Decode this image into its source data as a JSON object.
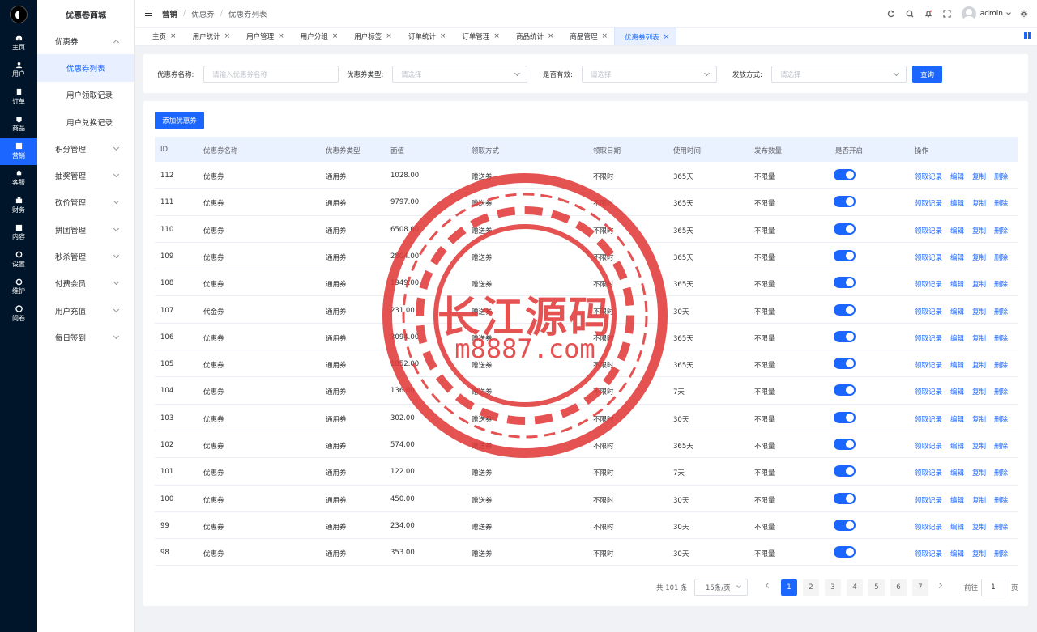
{
  "app": {
    "title": "优惠卷商城"
  },
  "rail": [
    {
      "label": "主页",
      "icon": "home-icon"
    },
    {
      "label": "用户",
      "icon": "user-icon"
    },
    {
      "label": "订单",
      "icon": "order-icon"
    },
    {
      "label": "商品",
      "icon": "goods-icon"
    },
    {
      "label": "营销",
      "icon": "marketing-icon",
      "active": true
    },
    {
      "label": "客服",
      "icon": "service-icon"
    },
    {
      "label": "财务",
      "icon": "finance-icon"
    },
    {
      "label": "内容",
      "icon": "content-icon"
    },
    {
      "label": "设置",
      "icon": "settings-icon"
    },
    {
      "label": "维护",
      "icon": "maintenance-icon"
    },
    {
      "label": "问卷",
      "icon": "survey-icon"
    }
  ],
  "submenu": {
    "group_open": "优惠券",
    "sub_items": [
      "优惠券列表",
      "用户领取记录",
      "用户兑换记录"
    ],
    "groups": [
      "积分管理",
      "抽奖管理",
      "砍价管理",
      "拼团管理",
      "秒杀管理",
      "付费会员",
      "用户充值",
      "每日签到"
    ]
  },
  "header": {
    "breadcrumb": [
      "营销",
      "优惠券",
      "优惠券列表"
    ],
    "user": "admin"
  },
  "tabs": [
    "主页",
    "用户统计",
    "用户管理",
    "用户分组",
    "用户标签",
    "订单统计",
    "订单管理",
    "商品统计",
    "商品管理",
    "优惠券列表"
  ],
  "filter": {
    "name_label": "优惠券名称:",
    "name_placeholder": "请输入优惠券名称",
    "type_label": "优惠券类型:",
    "type_placeholder": "请选择",
    "valid_label": "是否有效:",
    "valid_placeholder": "请选择",
    "issue_label": "发放方式:",
    "issue_placeholder": "请选择",
    "query_button": "查询"
  },
  "table": {
    "add_button": "添加优惠券",
    "columns": [
      "ID",
      "优惠券名称",
      "优惠券类型",
      "面值",
      "领取方式",
      "领取日期",
      "使用时间",
      "发布数量",
      "是否开启",
      "操作"
    ],
    "rows": [
      {
        "id": "112",
        "name": "优惠券",
        "type": "通用券",
        "value": "1028.00",
        "method": "赠送券",
        "date": "不限时",
        "use": "365天",
        "qty": "不限量",
        "on": true
      },
      {
        "id": "111",
        "name": "优惠券",
        "type": "通用券",
        "value": "9797.00",
        "method": "赠送券",
        "date": "不限时",
        "use": "365天",
        "qty": "不限量",
        "on": true
      },
      {
        "id": "110",
        "name": "优惠券",
        "type": "通用券",
        "value": "6508.00",
        "method": "赠送券",
        "date": "不限时",
        "use": "365天",
        "qty": "不限量",
        "on": true
      },
      {
        "id": "109",
        "name": "优惠券",
        "type": "通用券",
        "value": "2804.00",
        "method": "赠送券",
        "date": "不限时",
        "use": "365天",
        "qty": "不限量",
        "on": true
      },
      {
        "id": "108",
        "name": "优惠券",
        "type": "通用券",
        "value": "1949.00",
        "method": "赠送券",
        "date": "不限时",
        "use": "365天",
        "qty": "不限量",
        "on": true
      },
      {
        "id": "107",
        "name": "代金券",
        "type": "通用券",
        "value": "231.00",
        "method": "赠送券",
        "date": "不限时",
        "use": "30天",
        "qty": "不限量",
        "on": true
      },
      {
        "id": "106",
        "name": "优惠券",
        "type": "通用券",
        "value": "3094.00",
        "method": "赠送券",
        "date": "不限时",
        "use": "365天",
        "qty": "不限量",
        "on": true
      },
      {
        "id": "105",
        "name": "优惠券",
        "type": "通用券",
        "value": "1852.00",
        "method": "赠送券",
        "date": "不限时",
        "use": "365天",
        "qty": "不限量",
        "on": true
      },
      {
        "id": "104",
        "name": "优惠券",
        "type": "通用券",
        "value": "136.00",
        "method": "赠送券",
        "date": "不限时",
        "use": "7天",
        "qty": "不限量",
        "on": true
      },
      {
        "id": "103",
        "name": "优惠券",
        "type": "通用券",
        "value": "302.00",
        "method": "赠送券",
        "date": "不限时",
        "use": "30天",
        "qty": "不限量",
        "on": true
      },
      {
        "id": "102",
        "name": "优惠券",
        "type": "通用券",
        "value": "574.00",
        "method": "赠送券",
        "date": "不限时",
        "use": "365天",
        "qty": "不限量",
        "on": true
      },
      {
        "id": "101",
        "name": "优惠券",
        "type": "通用券",
        "value": "122.00",
        "method": "赠送券",
        "date": "不限时",
        "use": "7天",
        "qty": "不限量",
        "on": true
      },
      {
        "id": "100",
        "name": "优惠券",
        "type": "通用券",
        "value": "450.00",
        "method": "赠送券",
        "date": "不限时",
        "use": "30天",
        "qty": "不限量",
        "on": true
      },
      {
        "id": "99",
        "name": "优惠券",
        "type": "通用券",
        "value": "234.00",
        "method": "赠送券",
        "date": "不限时",
        "use": "30天",
        "qty": "不限量",
        "on": true
      },
      {
        "id": "98",
        "name": "优惠券",
        "type": "通用券",
        "value": "353.00",
        "method": "赠送券",
        "date": "不限时",
        "use": "30天",
        "qty": "不限量",
        "on": true
      }
    ],
    "actions": [
      "领取记录",
      "编辑",
      "复制",
      "删除"
    ]
  },
  "pagination": {
    "total": "共 101 条",
    "page_size": "15条/页",
    "pages": [
      "1",
      "2",
      "3",
      "4",
      "5",
      "6",
      "7"
    ],
    "current": "1",
    "jump_label": "前往",
    "jump_value": "1",
    "page_suffix": "页"
  },
  "watermark": {
    "line1": "长江源码",
    "line2": "m8887.com"
  },
  "colors": {
    "accent": "#1a66ff",
    "rail_bg": "#001529",
    "watermark": "#e23b3b"
  }
}
